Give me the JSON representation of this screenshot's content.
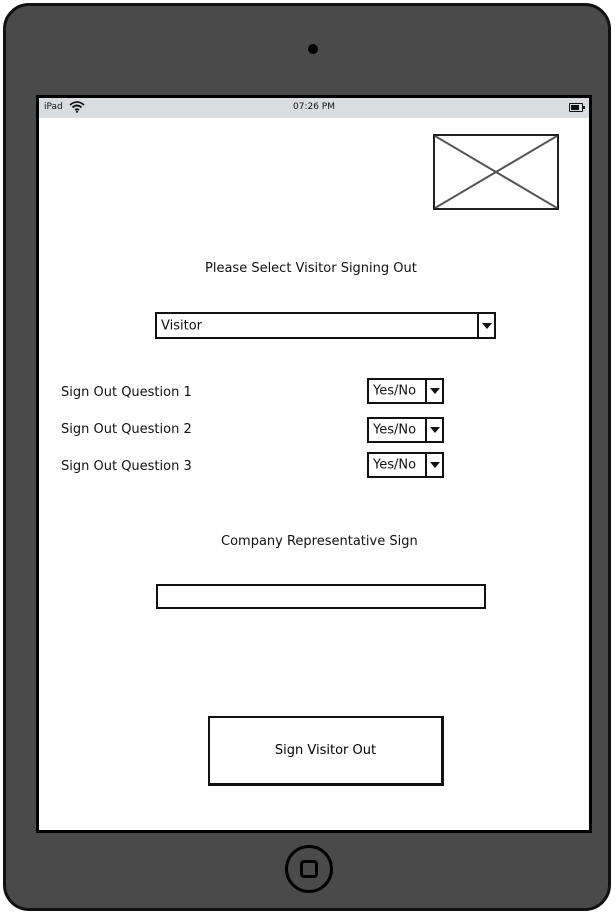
{
  "status_bar": {
    "carrier": "iPad",
    "wifi_icon": "wifi-icon",
    "time": "07:26 PM",
    "battery_icon": "battery-icon"
  },
  "logo": {
    "icon": "image-placeholder-icon"
  },
  "visitor_section": {
    "prompt": "Please Select Visitor Signing Out",
    "select_value": "Visitor"
  },
  "questions": [
    {
      "label": "Sign Out Question 1",
      "answer": "Yes/No"
    },
    {
      "label": "Sign Out Question 2",
      "answer": "Yes/No"
    },
    {
      "label": "Sign Out Question 3",
      "answer": "Yes/No"
    }
  ],
  "signature": {
    "label": "Company Representative Sign",
    "value": ""
  },
  "actions": {
    "sign_out_label": "Sign Visitor Out"
  }
}
